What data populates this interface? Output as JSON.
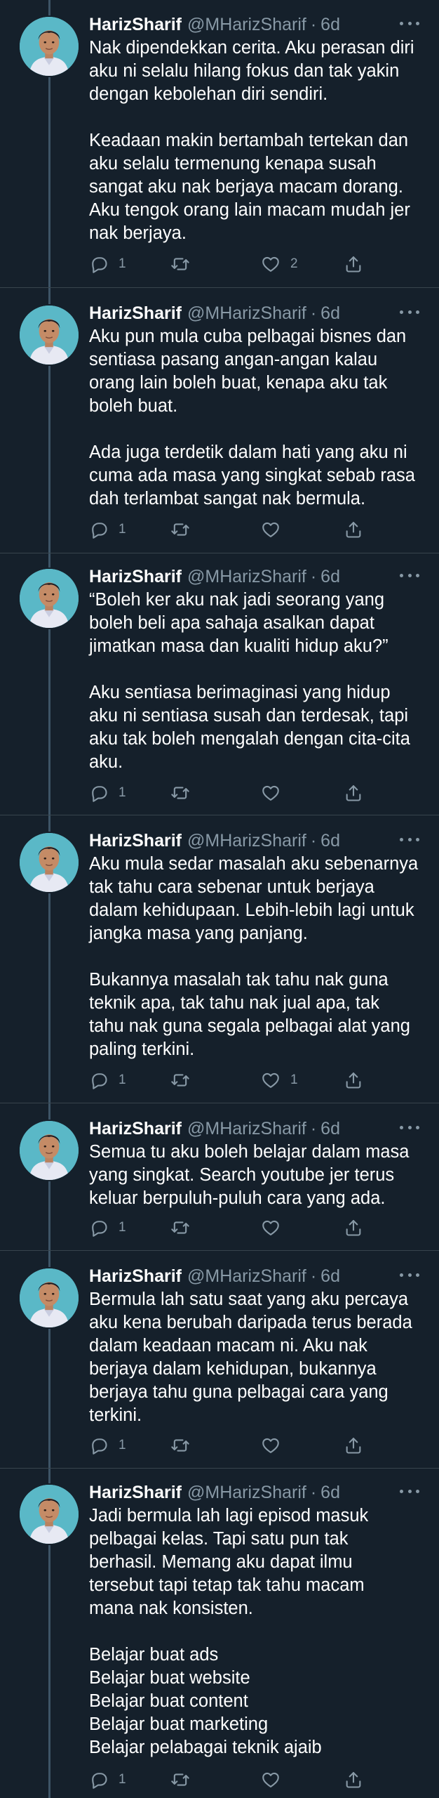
{
  "tweets": [
    {
      "name": "HarizSharif",
      "handle": "@MHarizSharif",
      "time": "6d",
      "paragraphs": [
        "Nak dipendekkan cerita. Aku perasan diri\naku ni selalu hilang fokus dan tak yakin\ndengan kebolehan diri sendiri.",
        "Keadaan makin bertambah tertekan dan\naku selalu termenung kenapa susah\nsangat aku nak berjaya macam dorang.\nAku tengok orang lain macam mudah jer\nnak berjaya."
      ],
      "replies": "1",
      "retweets": "",
      "likes": "2"
    },
    {
      "name": "HarizSharif",
      "handle": "@MHarizSharif",
      "time": "6d",
      "paragraphs": [
        "Aku pun mula cuba pelbagai bisnes dan\nsentiasa pasang angan-angan kalau\norang lain boleh buat, kenapa aku tak\nboleh buat.",
        "Ada juga terdetik dalam hati yang aku ni\ncuma ada masa yang singkat sebab rasa\ndah terlambat sangat nak bermula."
      ],
      "replies": "1",
      "retweets": "",
      "likes": ""
    },
    {
      "name": "HarizSharif",
      "handle": "@MHarizSharif",
      "time": "6d",
      "paragraphs": [
        "“Boleh ker aku nak jadi seorang yang\nboleh beli apa sahaja asalkan dapat\njimatkan masa dan kualiti hidup aku?”",
        "Aku sentiasa berimaginasi yang hidup\naku ni sentiasa susah dan terdesak, tapi\naku tak boleh mengalah dengan cita-cita\naku."
      ],
      "replies": "1",
      "retweets": "",
      "likes": ""
    },
    {
      "name": "HarizSharif",
      "handle": "@MHarizSharif",
      "time": "6d",
      "paragraphs": [
        "Aku mula sedar masalah aku sebenarnya\ntak tahu cara sebenar untuk berjaya\ndalam kehidupaan. Lebih-lebih lagi untuk\njangka masa yang panjang.",
        "Bukannya masalah tak tahu nak guna\nteknik apa, tak tahu nak jual apa, tak\ntahu nak guna segala pelbagai alat yang\npaling terkini."
      ],
      "replies": "1",
      "retweets": "",
      "likes": "1"
    },
    {
      "name": "HarizSharif",
      "handle": "@MHarizSharif",
      "time": "6d",
      "paragraphs": [
        "Semua tu aku boleh belajar dalam masa\nyang singkat. Search youtube jer terus\nkeluar berpuluh-puluh cara yang ada."
      ],
      "replies": "1",
      "retweets": "",
      "likes": ""
    },
    {
      "name": "HarizSharif",
      "handle": "@MHarizSharif",
      "time": "6d",
      "paragraphs": [
        "Bermula lah satu saat yang aku percaya\naku kena berubah daripada terus berada\ndalam keadaan macam ni. Aku nak\nberjaya dalam kehidupan, bukannya\nberjaya tahu guna pelbagai cara yang\nterkini."
      ],
      "replies": "1",
      "retweets": "",
      "likes": ""
    },
    {
      "name": "HarizSharif",
      "handle": "@MHarizSharif",
      "time": "6d",
      "paragraphs": [
        "Jadi bermula lah lagi episod masuk\npelbagai kelas. Tapi satu pun tak\nberhasil. Memang aku dapat ilmu\ntersebut tapi tetap tak tahu macam\nmana nak konsisten.",
        "Belajar buat ads\nBelajar buat website\nBelajar buat content\nBelajar buat marketing\nBelajar pelabagai teknik ajaib"
      ],
      "replies": "1",
      "retweets": "",
      "likes": ""
    }
  ],
  "icons": {
    "reply": "reply-icon",
    "retweet": "retweet-icon",
    "like": "heart-icon",
    "share": "share-icon",
    "more": "more-icon"
  },
  "colors": {
    "background": "#15202b",
    "secondary_text": "#8899a6",
    "thread_line": "#3d5466",
    "divider": "#38444d",
    "avatar_bg": "#5ab8c7"
  }
}
